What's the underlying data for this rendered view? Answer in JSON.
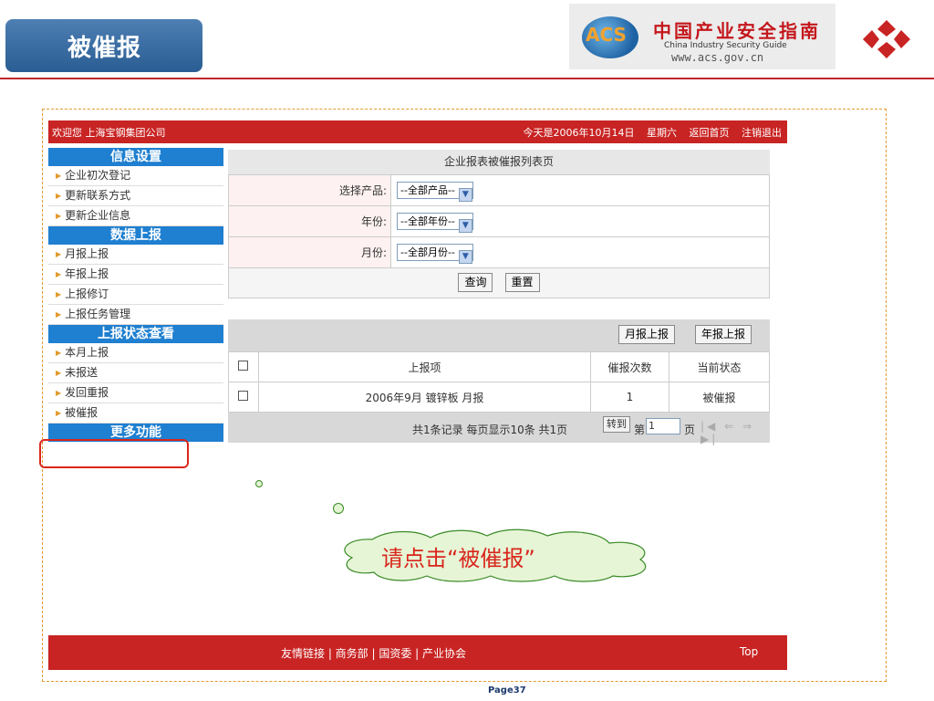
{
  "slide": {
    "title": "被催报",
    "page": "Page37"
  },
  "logo": {
    "acs": "ACS",
    "cn": "中国产业安全指南",
    "en": "China Industry Security Guide",
    "url": "www.acs.gov.cn"
  },
  "topbar": {
    "welcome": "欢迎您 上海宝钢集团公司",
    "date": "今天是2006年10月14日",
    "weekday": "星期六",
    "home": "返回首页",
    "logout": "注销退出"
  },
  "sidebar": {
    "sections": [
      {
        "title": "信息设置",
        "items": [
          "企业初次登记",
          "更新联系方式",
          "更新企业信息"
        ]
      },
      {
        "title": "数据上报",
        "items": [
          "月报上报",
          "年报上报",
          "上报修订",
          "上报任务管理"
        ]
      },
      {
        "title": "上报状态查看",
        "items": [
          "本月上报",
          "未报送",
          "发回重报",
          "被催报"
        ]
      },
      {
        "title": "更多功能",
        "items": []
      }
    ]
  },
  "main": {
    "page_title": "企业报表被催报列表页",
    "filters": [
      {
        "label": "选择产品:",
        "value": "--全部产品--"
      },
      {
        "label": "年份:",
        "value": "--全部年份--"
      },
      {
        "label": "月份:",
        "value": "--全部月份--"
      }
    ],
    "query_btn": "查询",
    "reset_btn": "重置",
    "monthly_btn": "月报上报",
    "annual_btn": "年报上报",
    "columns": [
      "上报项",
      "催报次数",
      "当前状态"
    ],
    "rows": [
      {
        "item": "2006年9月 镀锌板 月报",
        "count": "1",
        "status": "被催报"
      }
    ],
    "pager": {
      "info": "共1条记录  每页显示10条  共1页",
      "go": "转到",
      "pre": "第",
      "page": "1",
      "post": "页"
    }
  },
  "callout": {
    "text": "请点击“被催报”"
  },
  "footer": {
    "links": "友情链接 | 商务部 | 国资委 | 产业协会",
    "top": "Top"
  },
  "colors": {
    "accent_red": "#c82423",
    "side_blue": "#1f7fd0",
    "title_blue": "#2a5d93"
  }
}
